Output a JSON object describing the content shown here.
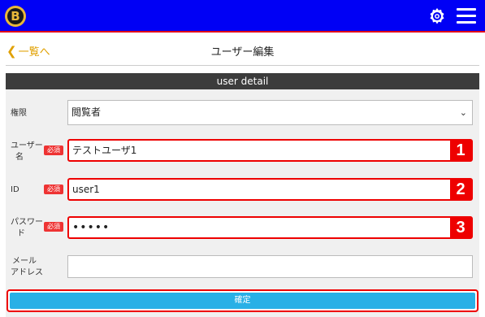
{
  "header": {
    "logo_letter": "B",
    "settings_icon": "gear-icon",
    "menu_icon": "hamburger-icon"
  },
  "nav": {
    "back_label": "一覧へ",
    "title": "ユーザー編集"
  },
  "panel": {
    "heading": "user detail"
  },
  "form": {
    "role": {
      "label": "権限",
      "value": "閲覧者"
    },
    "username": {
      "label_line1": "ユーザー",
      "label_line2": "名",
      "required": "必須",
      "value": "テストユーザ1",
      "marker": "1"
    },
    "id": {
      "label": "ID",
      "required": "必須",
      "value": "user1",
      "marker": "2"
    },
    "password": {
      "label_line1": "パスワー",
      "label_line2": "ド",
      "required": "必須",
      "value": "•••••",
      "marker": "3"
    },
    "email": {
      "label_line1": "メール",
      "label_line2": "アドレス",
      "value": ""
    }
  },
  "actions": {
    "confirm_label": "確定"
  },
  "colors": {
    "header_bg": "#0000f5",
    "accent_red": "#e00000",
    "confirm_bg": "#29b0e6"
  }
}
